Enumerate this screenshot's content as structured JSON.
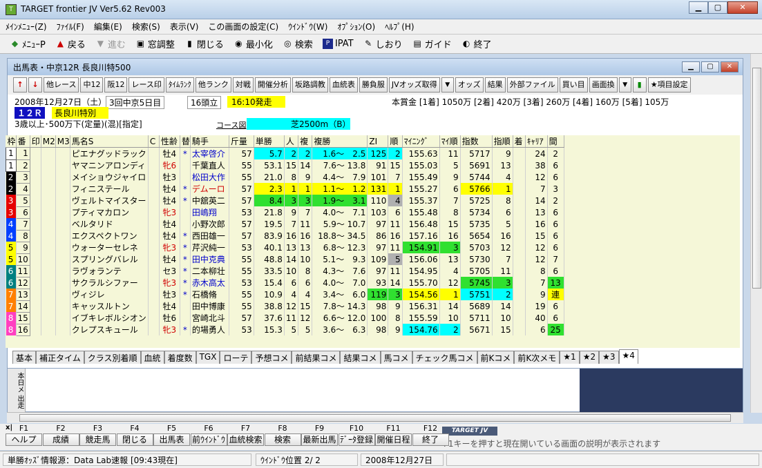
{
  "window": {
    "title": "TARGET frontier JV  Ver5.62  Rev003"
  },
  "menu": [
    "ﾒｲﾝﾒﾆｭｰ(Z)",
    "ﾌｧｲﾙ(F)",
    "編集(E)",
    "検索(S)",
    "表示(V)",
    "この画面の設定(C)",
    "ｳｲﾝﾄﾞｳ(W)",
    "ｵﾌﾟｼｮﾝ(O)",
    "ﾍﾙﾌﾟ(H)"
  ],
  "toolbar": [
    {
      "icon": "◆",
      "label": "ﾒﾆｭｰP"
    },
    {
      "icon": "▲",
      "label": "戻る"
    },
    {
      "icon": "▼",
      "label": "進む"
    },
    {
      "icon": "▣",
      "label": "窓調整"
    },
    {
      "icon": "▮",
      "label": "閉じる"
    },
    {
      "icon": "◉",
      "label": "最小化"
    },
    {
      "icon": "◎",
      "label": "検索"
    },
    {
      "icon": "P",
      "label": "IPAT"
    },
    {
      "icon": "✎",
      "label": "しおり"
    },
    {
      "icon": "▤",
      "label": "ガイド"
    },
    {
      "icon": "◐",
      "label": "終了"
    }
  ],
  "child": {
    "title": "出馬表・中京12R 長良川特500",
    "buttons": [
      "他レース",
      "中12",
      "阪12",
      "レース印",
      "ﾀｲﾑﾗﾝｸ",
      "他ランク",
      "対戦",
      "開催分析",
      "坂路調教",
      "血統表",
      "勝負服",
      "JVオッズ取得",
      "オッズ",
      "結果",
      "外部ファイル",
      "買い目",
      "画面換",
      "★項目設定"
    ]
  },
  "race": {
    "date": "2008年12月27日（土）",
    "meeting": "3回中京5日目",
    "runners": "16頭立",
    "post_time": "16:10発走",
    "prize": "本賞金 [1着] 1050万 [2着] 420万 [3着] 260万 [4着] 160万 [5着] 105万",
    "race_no": "１２Ｒ",
    "race_name": "長良川特別",
    "conditions": "3歳以上･500万下(定量)(混)[指定]",
    "course_label": "コース図",
    "course": "芝2500m（B）"
  },
  "columns": [
    "枠",
    "番",
    "印",
    "M2",
    "M3",
    "馬名S",
    "C",
    "性齢",
    "替",
    "騎手",
    "斤量",
    "単勝",
    "人",
    "複",
    "複勝",
    "ZI",
    "順",
    "ﾏｲﾆﾝｸﾞ",
    "ﾏｲ順",
    "指数",
    "指順",
    "着",
    "ｷｬﾘｱ",
    "間"
  ],
  "horses": [
    {
      "waku": "1",
      "ban": "1",
      "name": "ピエナグッドラック",
      "sex": "牡4",
      "sexcolor": "",
      "kae": "*",
      "jockey": "太宰啓介",
      "jcolor": "blue",
      "kin": "57",
      "tan": "5.7",
      "nin": "2",
      "fuku": "2",
      "fukusho": "1.6～　2.5",
      "zi": "125",
      "jun": "2",
      "mining": "155.63",
      "mjun": "11",
      "shisu": "5717",
      "sjun": "9",
      "chaku": "",
      "career": "24",
      "ma": "2",
      "hl": "cyan",
      "zihl": "cyan",
      "mhl": "",
      "shl": "",
      "mahl": ""
    },
    {
      "waku": "1",
      "ban": "2",
      "name": "ヤマニンアロンディ",
      "sex": "牝6",
      "sexcolor": "red",
      "kae": "",
      "jockey": "千葉直人",
      "jcolor": "",
      "kin": "55",
      "tan": "53.1",
      "nin": "15",
      "fuku": "14",
      "fukusho": "7.6～ 13.8",
      "zi": "91",
      "jun": "15",
      "mining": "155.03",
      "mjun": "5",
      "shisu": "5691",
      "sjun": "13",
      "chaku": "",
      "career": "38",
      "ma": "6",
      "hl": "",
      "zihl": "",
      "mhl": "",
      "shl": "",
      "mahl": ""
    },
    {
      "waku": "2",
      "ban": "3",
      "name": "メイショウジャイロ",
      "sex": "牡3",
      "sexcolor": "",
      "kae": "",
      "jockey": "松田大作",
      "jcolor": "blue",
      "kin": "55",
      "tan": "21.0",
      "nin": "8",
      "fuku": "9",
      "fukusho": "4.4～　7.9",
      "zi": "101",
      "jun": "7",
      "mining": "155.49",
      "mjun": "9",
      "shisu": "5744",
      "sjun": "4",
      "chaku": "",
      "career": "12",
      "ma": "6",
      "hl": "",
      "zihl": "",
      "mhl": "",
      "shl": "",
      "mahl": ""
    },
    {
      "waku": "2",
      "ban": "4",
      "name": "フィニステール",
      "sex": "牡4",
      "sexcolor": "",
      "kae": "*",
      "jockey": "デムーロ",
      "jcolor": "red",
      "kin": "57",
      "tan": "2.3",
      "nin": "1",
      "fuku": "1",
      "fukusho": "1.1～　1.2",
      "zi": "131",
      "jun": "1",
      "mining": "155.27",
      "mjun": "6",
      "shisu": "5766",
      "sjun": "1",
      "chaku": "",
      "career": "7",
      "ma": "3",
      "hl": "yellow",
      "zihl": "yellow",
      "mhl": "",
      "shl": "yellow",
      "mahl": ""
    },
    {
      "waku": "3",
      "ban": "5",
      "name": "ヴェルトマイスター",
      "sex": "牡4",
      "sexcolor": "",
      "kae": "*",
      "jockey": "中舘英二",
      "jcolor": "",
      "kin": "57",
      "tan": "8.4",
      "nin": "3",
      "fuku": "3",
      "fukusho": "1.9～　3.1",
      "zi": "110",
      "jun": "4",
      "mining": "155.37",
      "mjun": "7",
      "shisu": "5725",
      "sjun": "8",
      "chaku": "",
      "career": "14",
      "ma": "2",
      "hl": "green",
      "zihl": "gray",
      "mhl": "",
      "shl": "",
      "mahl": ""
    },
    {
      "waku": "3",
      "ban": "6",
      "name": "プティマカロン",
      "sex": "牝3",
      "sexcolor": "red",
      "kae": "",
      "jockey": "田嶋翔",
      "jcolor": "blue",
      "kin": "53",
      "tan": "21.8",
      "nin": "9",
      "fuku": "7",
      "fukusho": "4.0～　7.1",
      "zi": "103",
      "jun": "6",
      "mining": "155.48",
      "mjun": "8",
      "shisu": "5734",
      "sjun": "6",
      "chaku": "",
      "career": "13",
      "ma": "6",
      "hl": "",
      "zihl": "",
      "mhl": "",
      "shl": "",
      "mahl": ""
    },
    {
      "waku": "4",
      "ban": "7",
      "name": "ベルタリド",
      "sex": "牡4",
      "sexcolor": "",
      "kae": "",
      "jockey": "小野次郎",
      "jcolor": "",
      "kin": "57",
      "tan": "19.5",
      "nin": "7",
      "fuku": "11",
      "fukusho": "5.9～ 10.7",
      "zi": "97",
      "jun": "11",
      "mining": "156.48",
      "mjun": "15",
      "shisu": "5735",
      "sjun": "5",
      "chaku": "",
      "career": "16",
      "ma": "6",
      "hl": "",
      "zihl": "",
      "mhl": "",
      "shl": "",
      "mahl": ""
    },
    {
      "waku": "4",
      "ban": "8",
      "name": "エクスペクトワン",
      "sex": "牡4",
      "sexcolor": "",
      "kae": "*",
      "jockey": "西田雄一",
      "jcolor": "",
      "kin": "57",
      "tan": "83.9",
      "nin": "16",
      "fuku": "16",
      "fukusho": "18.8～ 34.5",
      "zi": "86",
      "jun": "16",
      "mining": "157.16",
      "mjun": "16",
      "shisu": "5654",
      "sjun": "16",
      "chaku": "",
      "career": "15",
      "ma": "6",
      "hl": "",
      "zihl": "",
      "mhl": "",
      "shl": "",
      "mahl": ""
    },
    {
      "waku": "5",
      "ban": "9",
      "name": "ウォーターセレネ",
      "sex": "牝3",
      "sexcolor": "red",
      "kae": "*",
      "jockey": "芹沢純一",
      "jcolor": "",
      "kin": "53",
      "tan": "40.1",
      "nin": "13",
      "fuku": "13",
      "fukusho": "6.8～ 12.3",
      "zi": "97",
      "jun": "11",
      "mining": "154.91",
      "mjun": "3",
      "shisu": "5703",
      "sjun": "12",
      "chaku": "",
      "career": "12",
      "ma": "6",
      "hl": "",
      "zihl": "",
      "mhl": "green",
      "shl": "",
      "mahl": ""
    },
    {
      "waku": "5",
      "ban": "10",
      "name": "スプリングバレル",
      "sex": "牡4",
      "sexcolor": "",
      "kae": "*",
      "jockey": "田中克典",
      "jcolor": "blue",
      "kin": "55",
      "tan": "48.8",
      "nin": "14",
      "fuku": "10",
      "fukusho": "5.1～　9.3",
      "zi": "109",
      "jun": "5",
      "mining": "156.06",
      "mjun": "13",
      "shisu": "5730",
      "sjun": "7",
      "chaku": "",
      "career": "12",
      "ma": "7",
      "hl": "",
      "zihl": "gray",
      "mhl": "",
      "shl": "",
      "mahl": ""
    },
    {
      "waku": "6",
      "ban": "11",
      "name": "ラヴォランテ",
      "sex": "セ3",
      "sexcolor": "",
      "kae": "*",
      "jockey": "二本柳壮",
      "jcolor": "",
      "kin": "55",
      "tan": "33.5",
      "nin": "10",
      "fuku": "8",
      "fukusho": "4.3～　7.6",
      "zi": "97",
      "jun": "11",
      "mining": "154.95",
      "mjun": "4",
      "shisu": "5705",
      "sjun": "11",
      "chaku": "",
      "career": "8",
      "ma": "6",
      "hl": "",
      "zihl": "",
      "mhl": "",
      "shl": "",
      "mahl": ""
    },
    {
      "waku": "6",
      "ban": "12",
      "name": "サクラルシファー",
      "sex": "牝3",
      "sexcolor": "red",
      "kae": "*",
      "jockey": "赤木高太",
      "jcolor": "blue",
      "kin": "53",
      "tan": "15.4",
      "nin": "6",
      "fuku": "6",
      "fukusho": "4.0～　7.0",
      "zi": "93",
      "jun": "14",
      "mining": "155.70",
      "mjun": "12",
      "shisu": "5745",
      "sjun": "3",
      "chaku": "",
      "career": "7",
      "ma": "13",
      "hl": "",
      "zihl": "",
      "mhl": "",
      "shl": "green",
      "mahl": "green"
    },
    {
      "waku": "7",
      "ban": "13",
      "name": "ヴィジレ",
      "sex": "牡3",
      "sexcolor": "",
      "kae": "*",
      "jockey": "石橋脩",
      "jcolor": "",
      "kin": "55",
      "tan": "10.9",
      "nin": "4",
      "fuku": "4",
      "fukusho": "3.4～　6.0",
      "zi": "119",
      "jun": "3",
      "mining": "154.56",
      "mjun": "1",
      "shisu": "5751",
      "sjun": "2",
      "chaku": "",
      "career": "9",
      "ma": "連",
      "hl": "",
      "zihl": "green",
      "mhl": "yellow",
      "shl": "cyan",
      "mahl": "yellow"
    },
    {
      "waku": "7",
      "ban": "14",
      "name": "キャッスルトン",
      "sex": "牡4",
      "sexcolor": "",
      "kae": "",
      "jockey": "田中博康",
      "jcolor": "",
      "kin": "55",
      "tan": "38.8",
      "nin": "12",
      "fuku": "15",
      "fukusho": "7.8～ 14.3",
      "zi": "98",
      "jun": "9",
      "mining": "156.31",
      "mjun": "14",
      "shisu": "5689",
      "sjun": "14",
      "chaku": "",
      "career": "19",
      "ma": "6",
      "hl": "",
      "zihl": "",
      "mhl": "",
      "shl": "",
      "mahl": ""
    },
    {
      "waku": "8",
      "ban": "15",
      "name": "イブキレボルシオン",
      "sex": "牡6",
      "sexcolor": "",
      "kae": "",
      "jockey": "宮崎北斗",
      "jcolor": "",
      "kin": "57",
      "tan": "37.6",
      "nin": "11",
      "fuku": "12",
      "fukusho": "6.6～ 12.0",
      "zi": "100",
      "jun": "8",
      "mining": "155.59",
      "mjun": "10",
      "shisu": "5711",
      "sjun": "10",
      "chaku": "",
      "career": "40",
      "ma": "6",
      "hl": "",
      "zihl": "",
      "mhl": "",
      "shl": "",
      "mahl": ""
    },
    {
      "waku": "8",
      "ban": "16",
      "name": "クレプスキュール",
      "sex": "牝3",
      "sexcolor": "red",
      "kae": "*",
      "jockey": "的場勇人",
      "jcolor": "",
      "kin": "53",
      "tan": "15.3",
      "nin": "5",
      "fuku": "5",
      "fukusho": "3.6～　6.3",
      "zi": "98",
      "jun": "9",
      "mining": "154.76",
      "mjun": "2",
      "shisu": "5671",
      "sjun": "15",
      "chaku": "",
      "career": "6",
      "ma": "25",
      "hl": "",
      "zihl": "",
      "mhl": "cyan",
      "shl": "",
      "mahl": "green"
    }
  ],
  "waku_labels": {
    "1": "1",
    "2": "2",
    "3": "3",
    "4": "4",
    "5": "5",
    "6": "6",
    "7": "7",
    "8": "8"
  },
  "tabs": [
    "基本",
    "補正タイム",
    "クラス別着順",
    "血統",
    "着度数",
    "TGX",
    "ローテ",
    "予想コメ",
    "前結果コメ",
    "結果コメ",
    "馬コメ",
    "チェック馬コメ",
    "前Kコメ",
    "前K次メモ",
    "★1",
    "★2",
    "★3",
    "★4"
  ],
  "side_label": "本日メ 出走",
  "fkeys": [
    {
      "key": "F1",
      "label": "ヘルプ"
    },
    {
      "key": "F2",
      "label": "成績"
    },
    {
      "key": "F3",
      "label": "競走馬"
    },
    {
      "key": "F4",
      "label": "閉じる"
    },
    {
      "key": "F5",
      "label": "出馬表"
    },
    {
      "key": "F6",
      "label": "前ｳｲﾝﾄﾞｳ"
    },
    {
      "key": "F7",
      "label": "血統検索"
    },
    {
      "key": "F8",
      "label": "検索"
    },
    {
      "key": "F9",
      "label": "最新出馬"
    },
    {
      "key": "F10",
      "label": "ﾃﾞｰﾀ登録"
    },
    {
      "key": "F11",
      "label": "開催日程"
    },
    {
      "key": "F12",
      "label": "終了"
    }
  ],
  "fkey_logo": "TARGET JV",
  "fkey_hint": "F1キーを押すと現在開いている画面の説明が表示されます",
  "status": {
    "source": "単勝ｵｯｽﾞ情報源：Data Lab速報 [09:43現在]",
    "window_pos": "ｳｲﾝﾄﾞｳ位置 2/ 2",
    "date": "2008年12月27日"
  },
  "colors": {
    "frame1": "#ffffff",
    "frame2": "#000000",
    "frame3": "#e60000",
    "frame4": "#0040ff",
    "frame5": "#ffff00",
    "frame6": "#008080",
    "frame7": "#ff8000",
    "frame8": "#ff40c0"
  }
}
